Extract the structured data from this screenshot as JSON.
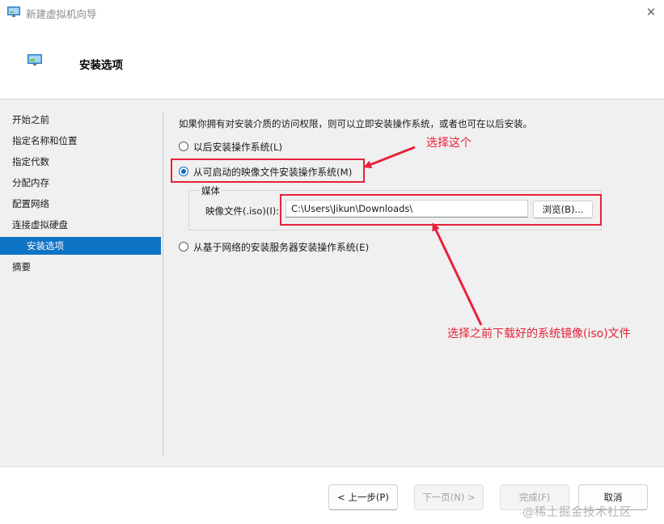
{
  "window": {
    "title": "新建虚拟机向导",
    "close_glyph": "✕"
  },
  "header": {
    "title": "安装选项"
  },
  "nav": {
    "items": [
      {
        "label": "开始之前"
      },
      {
        "label": "指定名称和位置"
      },
      {
        "label": "指定代数"
      },
      {
        "label": "分配内存"
      },
      {
        "label": "配置网络"
      },
      {
        "label": "连接虚拟硬盘"
      },
      {
        "label": "安装选项",
        "active": true
      },
      {
        "label": "摘要"
      }
    ]
  },
  "content": {
    "intro": "如果你拥有对安装介质的访问权限，则可以立即安装操作系统，或者也可在以后安装。",
    "options": [
      {
        "label": "以后安装操作系统(L)",
        "checked": false
      },
      {
        "label": "从可启动的映像文件安装操作系统(M)",
        "checked": true
      },
      {
        "label": "从基于网络的安装服务器安装操作系统(E)",
        "checked": false
      }
    ],
    "media": {
      "legend": "媒体",
      "iso_label": "映像文件(.iso)(I):",
      "iso_value": "C:\\Users\\Jikun\\Downloads\\",
      "browse_label": "浏览(B)..."
    }
  },
  "annotations": {
    "select_this": "选择这个",
    "select_iso": "选择之前下载好的系统镜像(iso)文件",
    "color": "#e8213a"
  },
  "footer": {
    "prev": "< 上一步(P)",
    "next": "下一页(N) >",
    "finish": "完成(F)",
    "cancel": "取消"
  },
  "watermark": "@稀土掘金技术社区",
  "colors": {
    "accent": "#0d73c4",
    "annotation": "#e8213a"
  }
}
